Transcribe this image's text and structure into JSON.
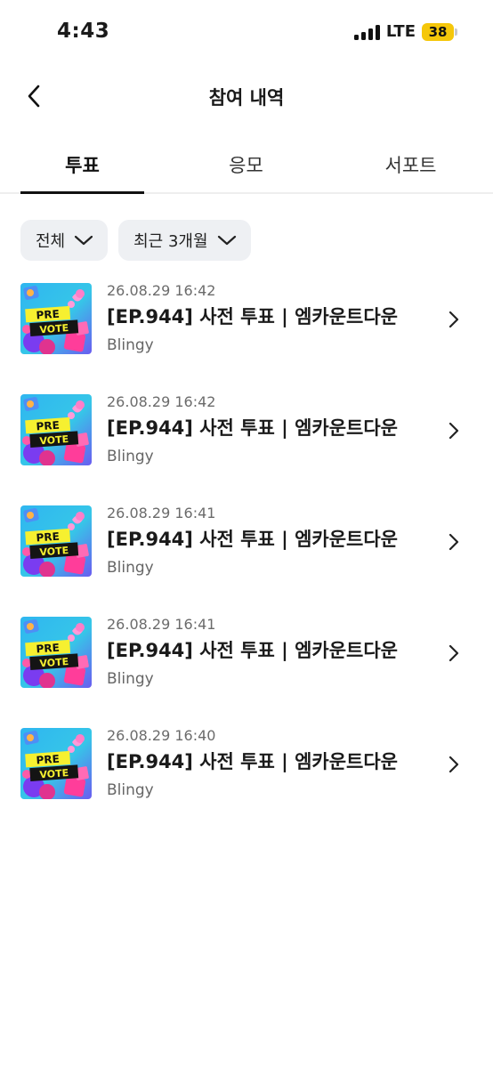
{
  "status_bar": {
    "time": "4:43",
    "network": "LTE",
    "battery": "38",
    "battery_color": "#f5c70a"
  },
  "header": {
    "title": "참여 내역",
    "back_icon": "chevron-left-icon"
  },
  "tabs": [
    {
      "label": "투표",
      "active": true
    },
    {
      "label": "응모",
      "active": false
    },
    {
      "label": "서포트",
      "active": false
    }
  ],
  "filters": [
    {
      "label": "전체",
      "icon": "chevron-down-icon"
    },
    {
      "label": "최근 3개월",
      "icon": "chevron-down-icon"
    }
  ],
  "thumbnail": {
    "line1": "PRE",
    "line2": "VOTE"
  },
  "items": [
    {
      "date": "26.08.29 16:42",
      "title": "[EP.944] 사전 투표 | 엠카운트다운",
      "source": "Blingy"
    },
    {
      "date": "26.08.29 16:42",
      "title": "[EP.944] 사전 투표 | 엠카운트다운",
      "source": "Blingy"
    },
    {
      "date": "26.08.29 16:41",
      "title": "[EP.944] 사전 투표 | 엠카운트다운",
      "source": "Blingy"
    },
    {
      "date": "26.08.29 16:41",
      "title": "[EP.944] 사전 투표 | 엠카운트다운",
      "source": "Blingy"
    },
    {
      "date": "26.08.29 16:40",
      "title": "[EP.944] 사전 투표 | 엠카운트다운",
      "source": "Blingy"
    }
  ]
}
